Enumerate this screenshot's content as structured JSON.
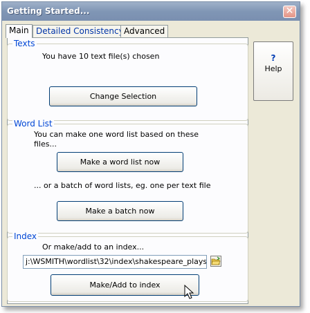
{
  "window": {
    "title": "Getting Started..."
  },
  "tabs": [
    {
      "label": "Main",
      "active": true
    },
    {
      "label": "Detailed Consistency",
      "active": false
    },
    {
      "label": "Advanced",
      "active": false
    }
  ],
  "help": {
    "label": "Help",
    "glyph": "?"
  },
  "texts": {
    "legend": "Texts",
    "info": "You have 10 text file(s) chosen",
    "change_button": "Change Selection"
  },
  "wordlist": {
    "legend": "Word List",
    "info_line1": "You can make one word list based on these",
    "info_line2": "files...",
    "make_button": "Make a word list now",
    "batch_info": "... or a batch of word lists, eg. one per text file",
    "batch_button": "Make a batch now"
  },
  "index": {
    "legend": "Index",
    "info": "Or make/add to an index...",
    "path_value": "j:\\WSMITH\\wordlist\\32\\index\\shakespeare_plays",
    "make_button": "Make/Add to index"
  }
}
